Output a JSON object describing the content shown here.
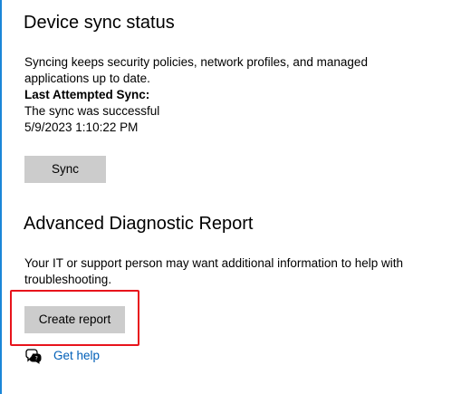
{
  "device_sync": {
    "title": "Device sync status",
    "description": "Syncing keeps security policies, network profiles, and managed applications up to date.",
    "last_sync_label": "Last Attempted Sync:",
    "last_sync_result": "The sync was successful",
    "last_sync_time": "5/9/2023 1:10:22 PM",
    "sync_button_label": "Sync"
  },
  "advanced_report": {
    "title": "Advanced Diagnostic Report",
    "description": "Your IT or support person may want additional information to help with troubleshooting.",
    "create_button_label": "Create report"
  },
  "help": {
    "link_label": "Get help",
    "icon": "chat-help-icon"
  },
  "colors": {
    "accent": "#1a86d8",
    "link": "#005fb8",
    "highlight": "#e8141c",
    "button": "#cccccc"
  }
}
